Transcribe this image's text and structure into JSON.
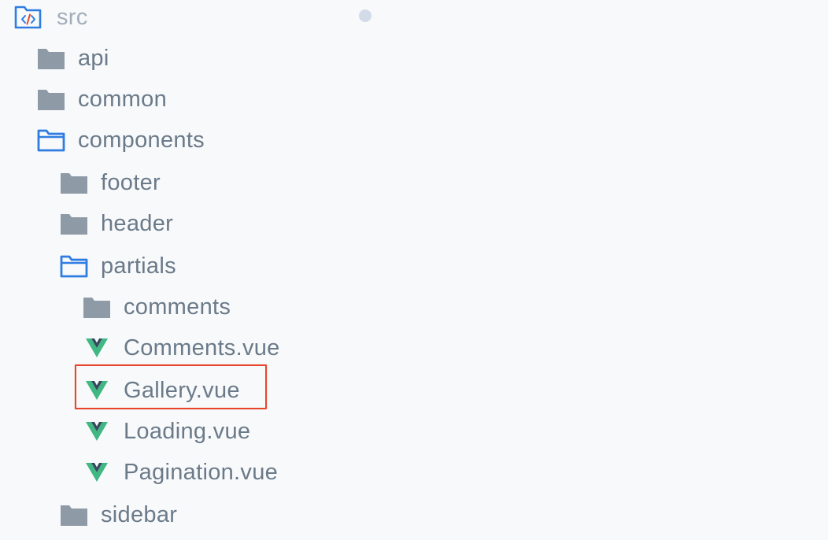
{
  "tree": {
    "root": {
      "label": "src",
      "icon": "source-folder-icon"
    },
    "items": [
      {
        "label": "api",
        "icon": "folder-closed-icon"
      },
      {
        "label": "common",
        "icon": "folder-closed-icon"
      },
      {
        "label": "components",
        "icon": "folder-open-icon"
      },
      {
        "label": "footer",
        "icon": "folder-closed-icon"
      },
      {
        "label": "header",
        "icon": "folder-closed-icon"
      },
      {
        "label": "partials",
        "icon": "folder-open-icon"
      },
      {
        "label": "comments",
        "icon": "folder-closed-icon"
      },
      {
        "label": "Comments.vue",
        "icon": "vue-file-icon"
      },
      {
        "label": "Gallery.vue",
        "icon": "vue-file-icon",
        "highlighted": true
      },
      {
        "label": "Loading.vue",
        "icon": "vue-file-icon"
      },
      {
        "label": "Pagination.vue",
        "icon": "vue-file-icon"
      },
      {
        "label": "sidebar",
        "icon": "folder-closed-icon"
      }
    ]
  },
  "colors": {
    "background": "#f8f9fb",
    "label_text": "#6b7a89",
    "root_text": "#a3aebb",
    "folder_closed": "#8e9aa6",
    "folder_open": "#2f7de1",
    "vue_green": "#41b883",
    "vue_dark": "#35495e",
    "highlight_border": "#e8462c"
  }
}
